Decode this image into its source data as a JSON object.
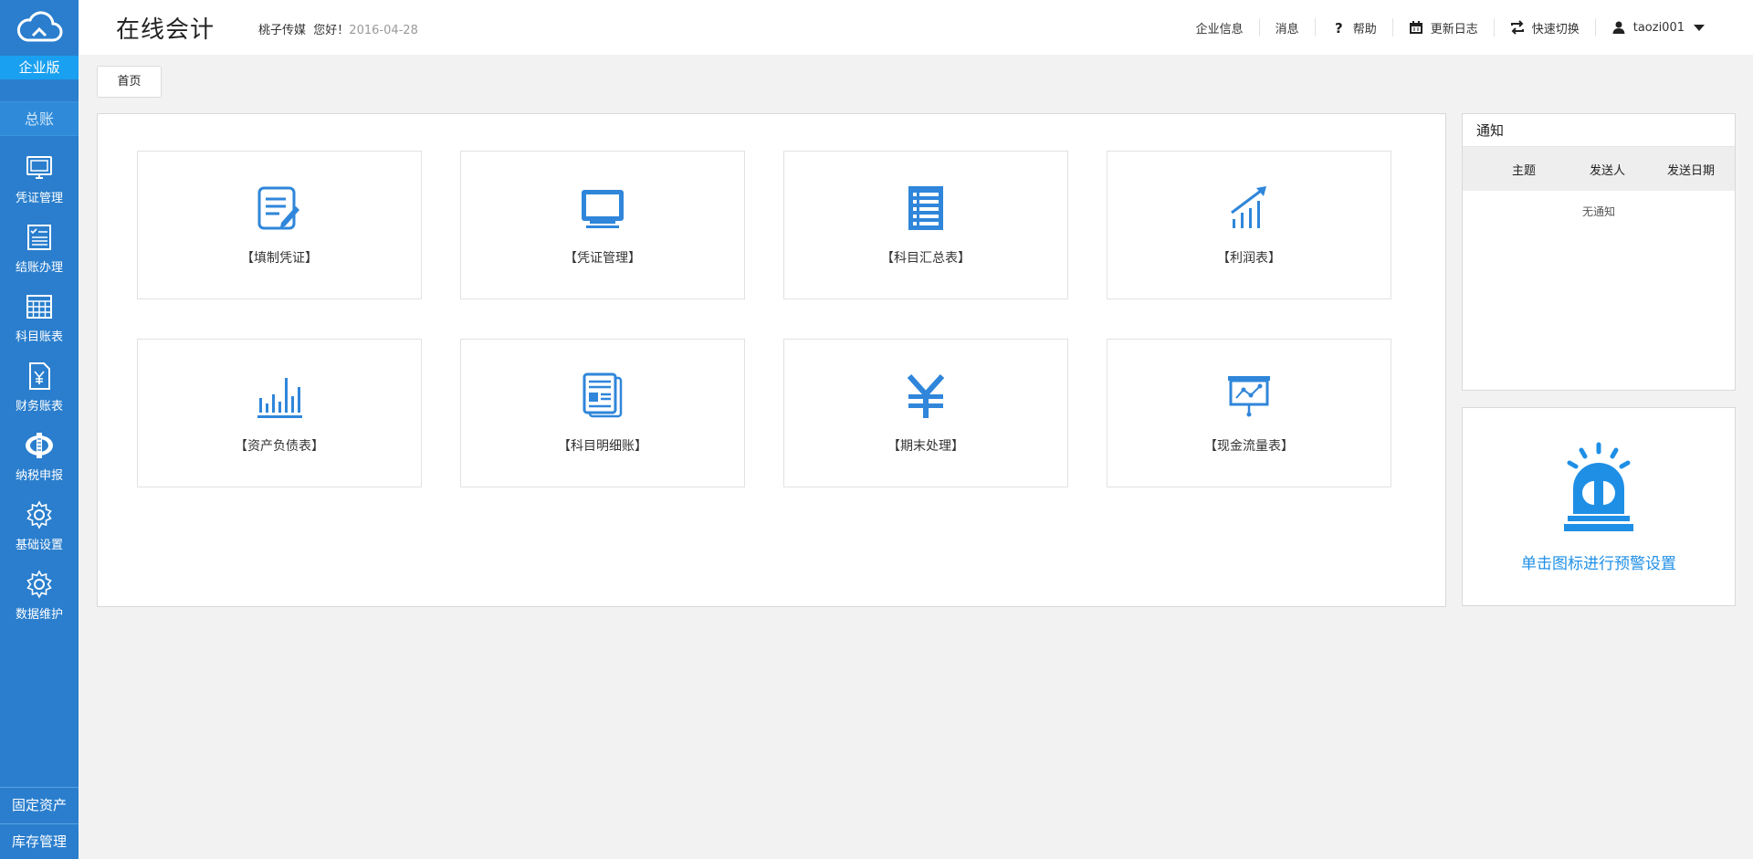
{
  "app": {
    "title": "在线会计",
    "edition": "企业版",
    "ledger": "总账"
  },
  "header": {
    "company": "桃子传媒",
    "greeting": "您好！",
    "date": "2016-04-28",
    "nav": {
      "company_info": "企业信息",
      "messages": "消息",
      "help": "帮助",
      "changelog": "更新日志",
      "quick_switch": "快速切换",
      "user": "taozi001"
    }
  },
  "sidebar": {
    "items": [
      {
        "label": "凭证管理",
        "icon": "monitor-icon"
      },
      {
        "label": "结账办理",
        "icon": "checklist-icon"
      },
      {
        "label": "科目账表",
        "icon": "table-grid-icon"
      },
      {
        "label": "财务账表",
        "icon": "yen-document-icon"
      },
      {
        "label": "纳税申报",
        "icon": "tax-emblem-icon"
      },
      {
        "label": "基础设置",
        "icon": "gear-icon"
      },
      {
        "label": "数据维护",
        "icon": "gear-icon"
      }
    ],
    "bottom": [
      "固定资产",
      "库存管理"
    ]
  },
  "tabs": {
    "home": "首页"
  },
  "tiles": [
    {
      "label": "【填制凭证】",
      "icon": "edit-document-icon"
    },
    {
      "label": "【凭证管理】",
      "icon": "monitor-icon"
    },
    {
      "label": "【科目汇总表】",
      "icon": "list-document-icon"
    },
    {
      "label": "【利润表】",
      "icon": "growth-chart-icon"
    },
    {
      "label": "【资产负债表】",
      "icon": "bar-chart-icon"
    },
    {
      "label": "【科目明细账】",
      "icon": "newspaper-icon"
    },
    {
      "label": "【期末处理】",
      "icon": "yen-icon"
    },
    {
      "label": "【现金流量表】",
      "icon": "presentation-chart-icon"
    }
  ],
  "notice": {
    "title": "通知",
    "columns": [
      "主题",
      "发送人",
      "发送日期"
    ],
    "empty": "无通知"
  },
  "alarm": {
    "text": "单击图标进行预警设置",
    "icon": "siren-icon"
  },
  "colors": {
    "sidebar": "#2a7ecd",
    "edition_bg": "#1aa0f0",
    "icon_blue": "#2f86da",
    "accent": "#1f8fe6"
  }
}
